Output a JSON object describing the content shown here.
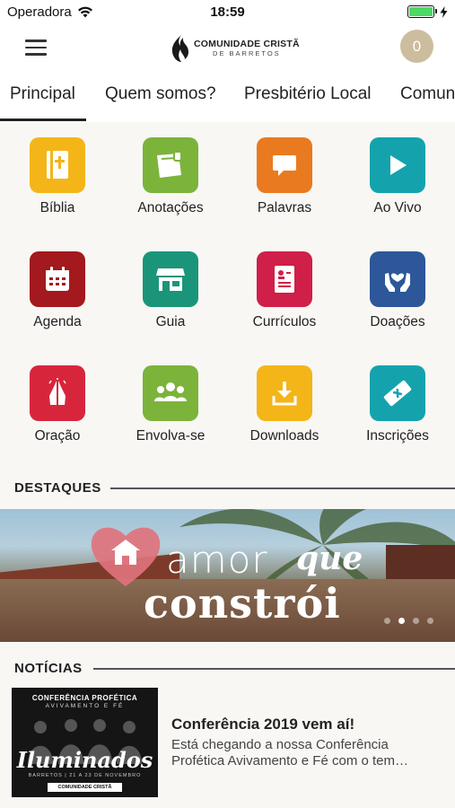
{
  "status_bar": {
    "carrier": "Operadora",
    "time": "18:59"
  },
  "header": {
    "logo_line1": "COMUNIDADE CRISTÃ",
    "logo_line2": "DE BARRETOS",
    "cart_count": "0"
  },
  "tabs": [
    {
      "label": "Principal",
      "active": true
    },
    {
      "label": "Quem somos?"
    },
    {
      "label": "Presbitério Local"
    },
    {
      "label": "Comun"
    }
  ],
  "grid": [
    {
      "label": "Bíblia",
      "icon": "bible-icon",
      "color": "#f4b518"
    },
    {
      "label": "Anotações",
      "icon": "notes-icon",
      "color": "#7cb33b"
    },
    {
      "label": "Palavras",
      "icon": "speech-bubble-icon",
      "color": "#ea7a1f"
    },
    {
      "label": "Ao Vivo",
      "icon": "play-icon",
      "color": "#14a3ad"
    },
    {
      "label": "Agenda",
      "icon": "calendar-icon",
      "color": "#a3191d"
    },
    {
      "label": "Guia",
      "icon": "store-icon",
      "color": "#1b957a"
    },
    {
      "label": "Currículos",
      "icon": "resume-icon",
      "color": "#d01f48"
    },
    {
      "label": "Doações",
      "icon": "donation-hands-icon",
      "color": "#2d5798"
    },
    {
      "label": "Oração",
      "icon": "praying-hands-icon",
      "color": "#d7263c"
    },
    {
      "label": "Envolva-se",
      "icon": "group-icon",
      "color": "#7cb33b"
    },
    {
      "label": "Downloads",
      "icon": "download-icon",
      "color": "#f4b518"
    },
    {
      "label": "Inscrições",
      "icon": "ticket-icon",
      "color": "#14a3ad"
    }
  ],
  "highlights": {
    "title": "DESTAQUES",
    "banner": {
      "word1": "amor",
      "word2": "que",
      "word3": "constrói"
    },
    "slides": 4,
    "active_slide": 2
  },
  "news": {
    "title": "NOTÍCIAS",
    "items": [
      {
        "title": "Conferência 2019 vem aí!",
        "description": "Está chegando a nossa Conferência Profética Avivamento e Fé com o tem…",
        "thumb_line1": "CONFERÊNCIA PROFÉTICA",
        "thumb_line2": "AVIVAMENTO E FÉ",
        "thumb_script": "Iluminados",
        "thumb_date": "BARRETOS | 21 A 23 DE NOVEMBRO",
        "thumb_logo": "COMUNIDADE CRISTÃ"
      }
    ]
  }
}
